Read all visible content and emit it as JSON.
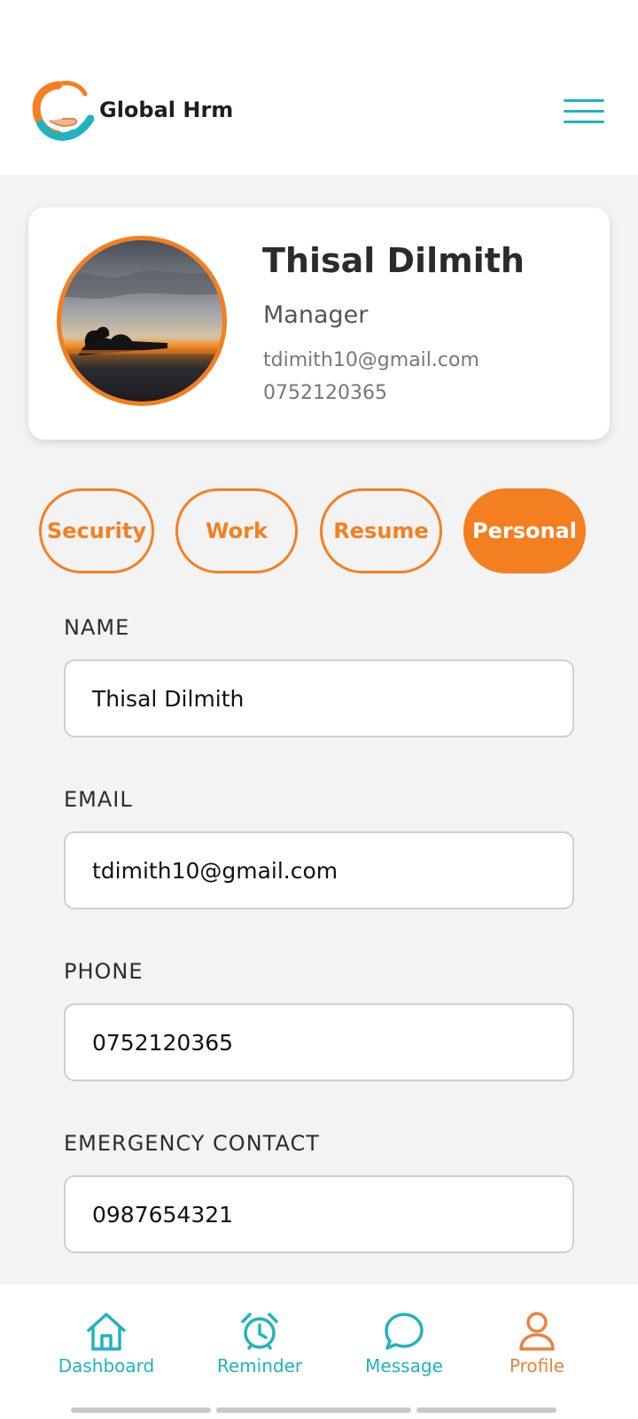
{
  "header": {
    "app_title": "Global Hrm",
    "menu_icon": "hamburger-menu-icon",
    "accent_color": "#1fb3bf"
  },
  "profile": {
    "name": "Thisal Dilmith",
    "role": "Manager",
    "email": "tdimith10@gmail.com",
    "phone": "0752120365"
  },
  "tabs": [
    {
      "label": "Security",
      "active": false
    },
    {
      "label": "Work",
      "active": false
    },
    {
      "label": "Resume",
      "active": false
    },
    {
      "label": "Personal",
      "active": true
    }
  ],
  "form": {
    "fields": [
      {
        "label": "NAME",
        "value": "Thisal Dilmith"
      },
      {
        "label": "EMAIL",
        "value": "tdimith10@gmail.com"
      },
      {
        "label": "PHONE",
        "value": "0752120365"
      },
      {
        "label": "EMERGENCY CONTACT",
        "value": "0987654321"
      }
    ]
  },
  "bottom_nav": {
    "items": [
      {
        "label": "Dashboard",
        "icon": "home-icon",
        "active": false
      },
      {
        "label": "Reminder",
        "icon": "alarm-clock-icon",
        "active": false
      },
      {
        "label": "Message",
        "icon": "chat-bubble-icon",
        "active": false
      },
      {
        "label": "Profile",
        "icon": "user-icon",
        "active": true
      }
    ]
  },
  "colors": {
    "brand_orange": "#f47f20",
    "brand_teal": "#1fb3bf",
    "background": "#f3f3f3"
  }
}
